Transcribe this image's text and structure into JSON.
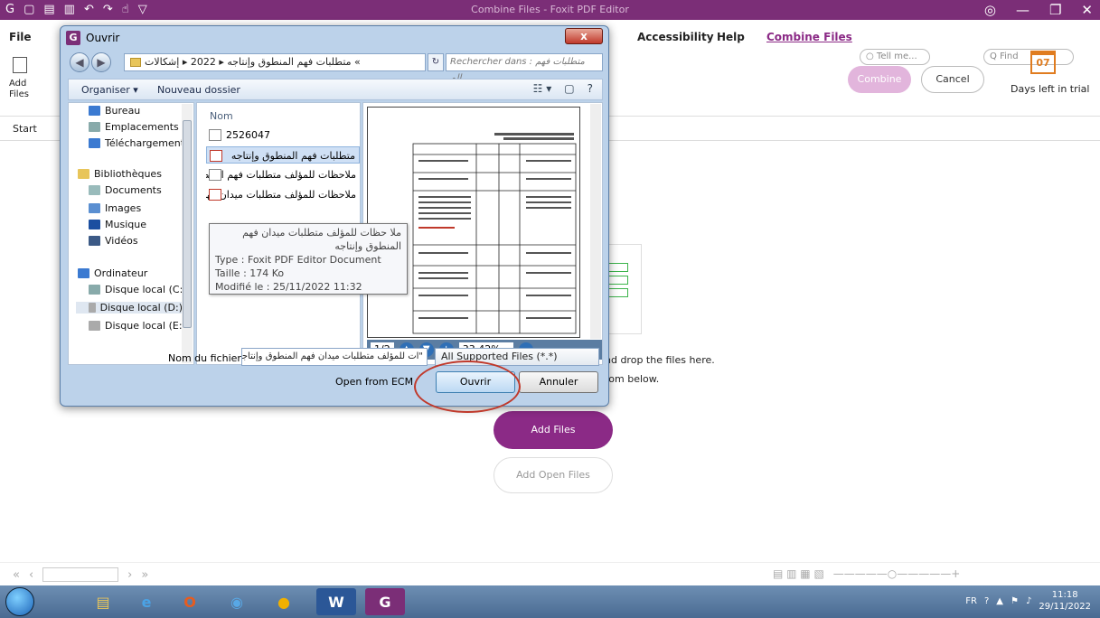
{
  "app": {
    "title": "Combine Files - Foxit PDF Editor",
    "menu": [
      "File",
      "Accessibility",
      "Help",
      "Combine Files"
    ],
    "tell_me": "Tell me...",
    "find": "Find",
    "ribbon": {
      "add_files": "Add\nFiles",
      "combine": "Combine",
      "cancel": "Cancel",
      "trial_days": "07",
      "trial_label": "Days left in trial"
    },
    "tab": "Start",
    "dropzone_line1": "nd drop the files here.",
    "dropzone_line2": "rom below.",
    "add_files_button": "Add Files",
    "add_open_files_button": "Add Open Files"
  },
  "dialog": {
    "title": "Ouvrir",
    "address": "متطلبات فهم المنطوق وإنتاجه ▸ 2022 ▸ إشكالات «",
    "search_placeholder": "Rechercher dans : متطلبات فهم الم..",
    "toolbar": {
      "organize": "Organiser ▾",
      "new_folder": "Nouveau dossier"
    },
    "nav_items": [
      {
        "label": "Bureau",
        "color": "#3b7ad1"
      },
      {
        "label": "Emplacements ré",
        "color": "#8aa"
      },
      {
        "label": "Téléchargements",
        "color": "#3b7ad1"
      },
      {
        "label": "Bibliothèques",
        "color": "#e8c55a"
      },
      {
        "label": "Documents",
        "color": "#9bb"
      },
      {
        "label": "Images",
        "color": "#5a8fd1"
      },
      {
        "label": "Musique",
        "color": "#1b4fa0"
      },
      {
        "label": "Vidéos",
        "color": "#3c5a86"
      },
      {
        "label": "Ordinateur",
        "color": "#3b7ad1"
      },
      {
        "label": "Disque local (C:)",
        "color": "#8aa"
      },
      {
        "label": "Disque local (D:)",
        "color": "#aaa"
      },
      {
        "label": "Disque local (E:)",
        "color": "#aaa"
      }
    ],
    "column_name": "Nom",
    "files": [
      {
        "name": "2526047"
      },
      {
        "name": "متطلبات فهم المنطوق وإنتاجه"
      },
      {
        "name": "ملاحظات للمؤلف  متطلبات فهم المنطوق وإنت"
      },
      {
        "name": "ملاحظات للمؤلف  متطلبات ميدان فهم المنطوق وإنت"
      }
    ],
    "tooltip": {
      "name": "ملا حظات للمؤلف  متطلبات ميدان فهم المنطوق وإنتاجه",
      "type": "Type : Foxit PDF Editor Document",
      "size": "Taille : 174 Ko",
      "modified": "Modifié le : 25/11/2022 11:32"
    },
    "preview": {
      "page": "1/2",
      "zoom": "33.42%"
    },
    "filename_label": "Nom du fichier :",
    "filename_value": "\"ات للمؤلف  متطلبات ميدان فهم المنطوق وإنتاجه",
    "filetype": "All Supported Files (*.*)",
    "open_from_ecm": "Open from ECM",
    "open_button": "Ouvrir",
    "cancel_button": "Annuler"
  },
  "taskbar": {
    "lang": "FR",
    "time": "11:18",
    "date": "29/11/2022"
  }
}
